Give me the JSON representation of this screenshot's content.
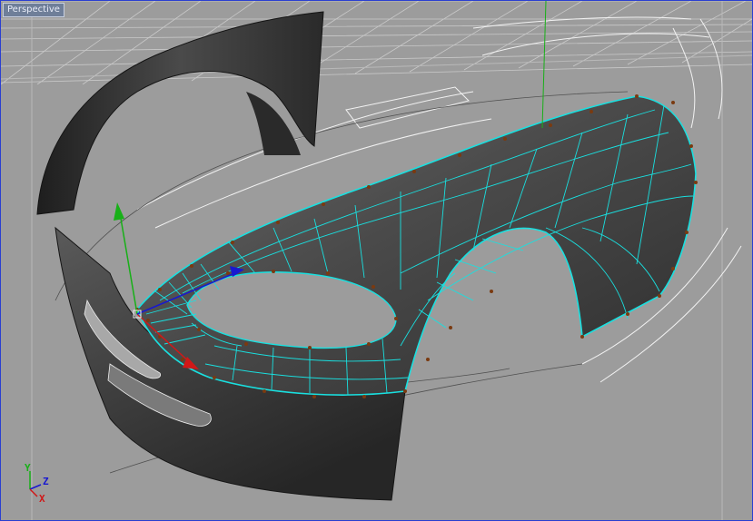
{
  "viewport": {
    "label": "Perspective"
  },
  "axes": {
    "x": "X",
    "y": "Y",
    "z": "Z",
    "colors": {
      "x": "#d01818",
      "y": "#18b018",
      "z": "#1818d0"
    }
  },
  "colors": {
    "background": "#9c9c9c",
    "grid": "#b8b8b8",
    "wire": "#19e0e0",
    "vertex": "#7a3a10",
    "spline": "#f4f4f4",
    "frame": "#2a3fd0"
  },
  "gizmo": {
    "icons": [
      "move-y-arrow-icon",
      "move-x-arrow-icon",
      "move-z-arrow-icon"
    ]
  }
}
